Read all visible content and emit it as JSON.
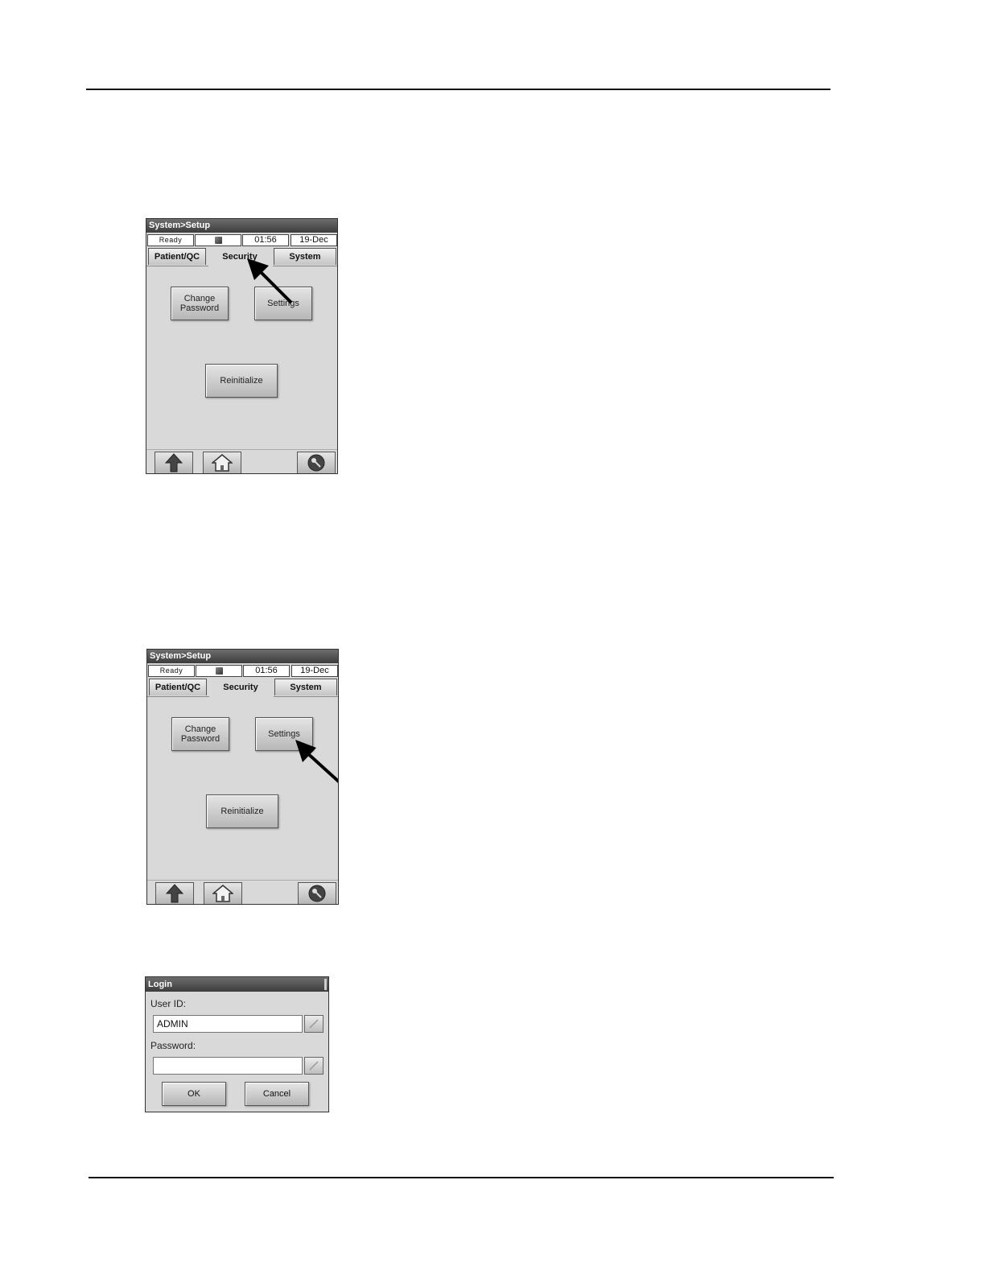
{
  "screens": [
    {
      "title": "System>Setup",
      "status": {
        "state": "Ready",
        "time": "01:56",
        "date": "19-Dec"
      },
      "tabs": [
        "Patient/QC",
        "Security",
        "System"
      ],
      "active_tab": "Security",
      "buttons": {
        "change_password": "Change\nPassword",
        "settings": "Settings",
        "reinitialize": "Reinitialize"
      },
      "footer_icons": [
        "up-arrow-icon",
        "home-icon",
        "key-icon"
      ],
      "callout": "arrow pointing to Security tab"
    },
    {
      "title": "System>Setup",
      "status": {
        "state": "Ready",
        "time": "01:56",
        "date": "19-Dec"
      },
      "tabs": [
        "Patient/QC",
        "Security",
        "System"
      ],
      "active_tab": "Security",
      "buttons": {
        "change_password": "Change\nPassword",
        "settings": "Settings",
        "reinitialize": "Reinitialize"
      },
      "footer_icons": [
        "up-arrow-icon",
        "home-icon",
        "key-icon"
      ],
      "callout": "arrow pointing to Settings button"
    }
  ],
  "login": {
    "title": "Login",
    "user_label": "User ID:",
    "user_value": "ADMIN",
    "password_label": "Password:",
    "password_value": "",
    "ok_label": "OK",
    "cancel_label": "Cancel"
  },
  "colors": {
    "titlebar": "#4a4a4a",
    "panel": "#d9d9d9",
    "arrow": "#000000"
  }
}
